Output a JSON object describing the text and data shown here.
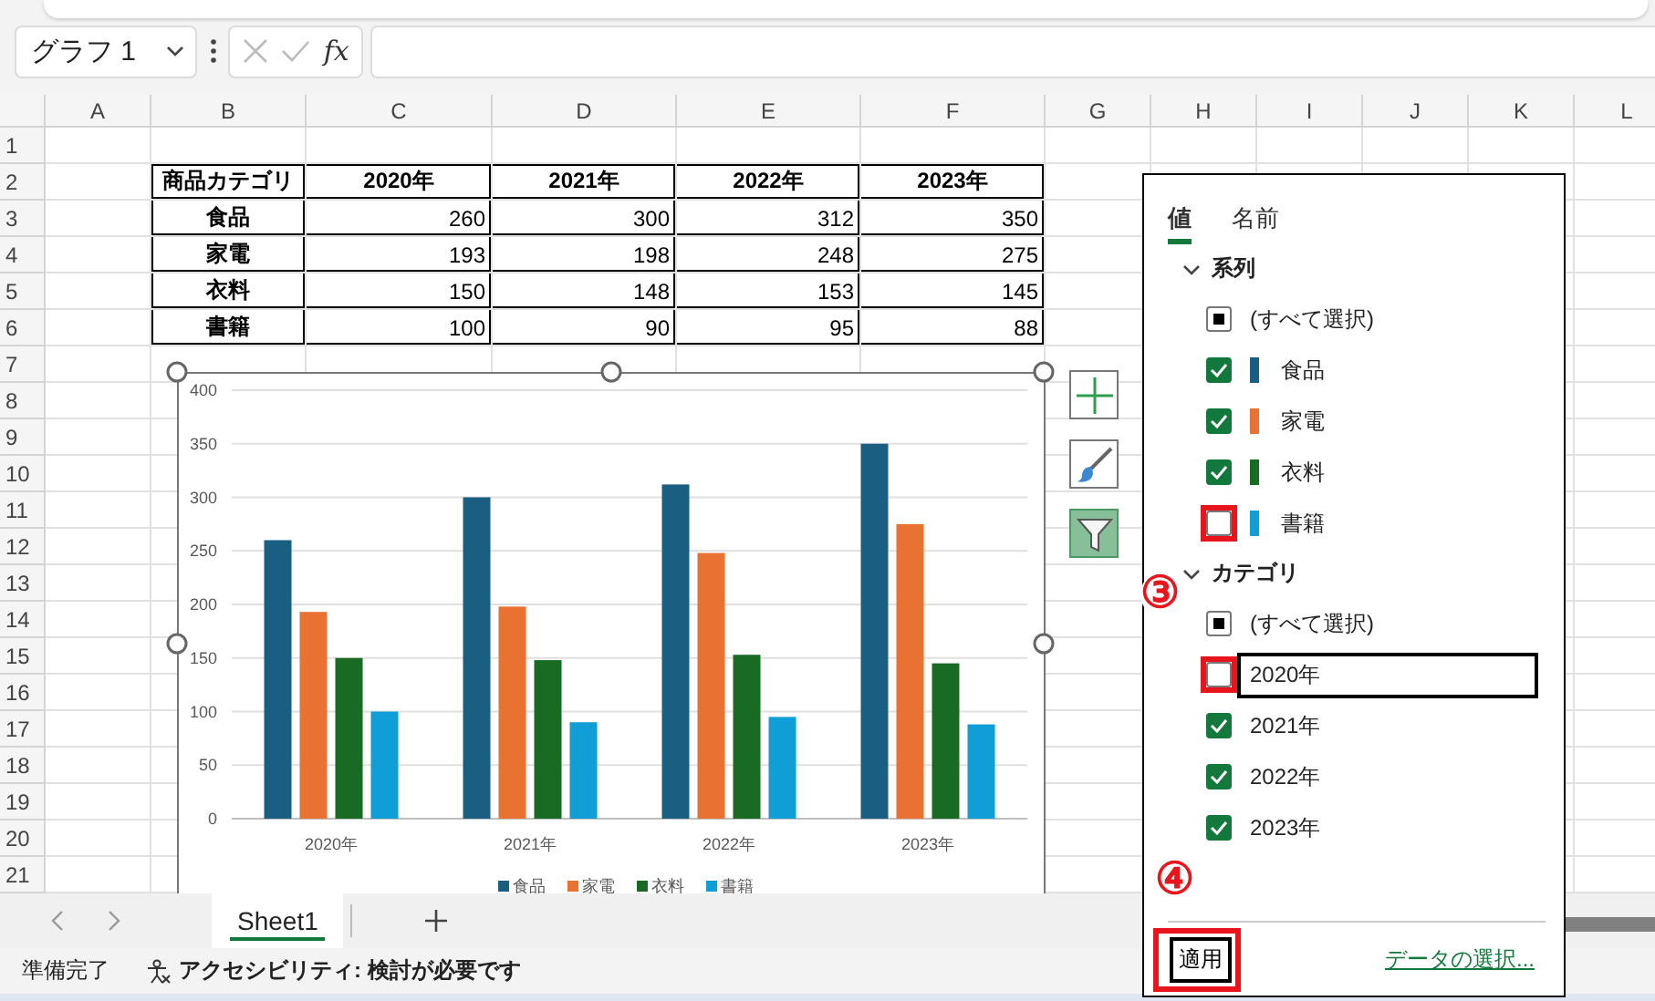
{
  "name_box": {
    "value": "グラフ 1"
  },
  "formula_bar": {
    "function_label": "fx"
  },
  "sheet": {
    "columns": [
      "A",
      "B",
      "C",
      "D",
      "E",
      "F",
      "G",
      "H",
      "I",
      "J",
      "K",
      "L"
    ],
    "rows": [
      "1",
      "2",
      "3",
      "4",
      "5",
      "6",
      "7",
      "8",
      "9",
      "10",
      "11",
      "12",
      "13",
      "14",
      "15",
      "16",
      "17",
      "18",
      "19",
      "20",
      "21"
    ],
    "table": {
      "header": [
        "商品カテゴリ",
        "2020年",
        "2021年",
        "2022年",
        "2023年"
      ],
      "rows": [
        {
          "category": "食品",
          "values": [
            "260",
            "300",
            "312",
            "350"
          ]
        },
        {
          "category": "家電",
          "values": [
            "193",
            "198",
            "248",
            "275"
          ]
        },
        {
          "category": "衣料",
          "values": [
            "150",
            "148",
            "153",
            "145"
          ]
        },
        {
          "category": "書籍",
          "values": [
            "100",
            "90",
            "95",
            "88"
          ]
        }
      ]
    }
  },
  "chart": {
    "chart_data": {
      "type": "bar",
      "categories": [
        "2020年",
        "2021年",
        "2022年",
        "2023年"
      ],
      "series": [
        {
          "name": "食品",
          "color": "#1a5e82",
          "values": [
            260,
            300,
            312,
            350
          ]
        },
        {
          "name": "家電",
          "color": "#e97132",
          "values": [
            193,
            198,
            248,
            275
          ]
        },
        {
          "name": "衣料",
          "color": "#196b24",
          "values": [
            150,
            148,
            153,
            145
          ]
        },
        {
          "name": "書籍",
          "color": "#0f9ed5",
          "values": [
            100,
            90,
            95,
            88
          ]
        }
      ],
      "grid": true,
      "legend": true,
      "ylim": [
        0,
        400
      ],
      "yticks": [
        {
          "value": 0,
          "label": "0"
        },
        {
          "value": 50,
          "label": "50"
        },
        {
          "value": 100,
          "label": "100"
        },
        {
          "value": 150,
          "label": "150"
        },
        {
          "value": 200,
          "label": "200"
        },
        {
          "value": 250,
          "label": "250"
        },
        {
          "value": 300,
          "label": "300"
        },
        {
          "value": 350,
          "label": "350"
        },
        {
          "value": 400,
          "label": "400"
        }
      ]
    }
  },
  "chart_buttons": [
    {
      "kind": "elements",
      "selected": false
    },
    {
      "kind": "styles",
      "selected": false
    },
    {
      "kind": "filter",
      "selected": true
    }
  ],
  "filter_pane": {
    "tabs": [
      {
        "label": "値",
        "selected": true
      },
      {
        "label": "名前",
        "selected": false
      }
    ],
    "sections": [
      {
        "title": "系列",
        "expanded": true,
        "items": [
          {
            "kind": "all",
            "label": "(すべて選択)",
            "indeterminate": true,
            "focused": false,
            "highlighted": false
          },
          {
            "kind": "series",
            "label": "食品",
            "color": "#1a5e82",
            "checked": true,
            "focused": false,
            "highlighted": false
          },
          {
            "kind": "series",
            "label": "家電",
            "color": "#e97132",
            "checked": true,
            "focused": false,
            "highlighted": false
          },
          {
            "kind": "series",
            "label": "衣料",
            "color": "#196b24",
            "checked": true,
            "focused": false,
            "highlighted": false
          },
          {
            "kind": "series",
            "label": "書籍",
            "color": "#0f9ed5",
            "checked": false,
            "focused": false,
            "highlighted": true
          }
        ]
      },
      {
        "title": "カテゴリ",
        "expanded": true,
        "items": [
          {
            "kind": "all",
            "label": "(すべて選択)",
            "indeterminate": true,
            "focused": false,
            "highlighted": false
          },
          {
            "kind": "category",
            "label": "2020年",
            "checked": false,
            "focused": true,
            "highlighted": true
          },
          {
            "kind": "category",
            "label": "2021年",
            "checked": true,
            "focused": false,
            "highlighted": false
          },
          {
            "kind": "category",
            "label": "2022年",
            "checked": true,
            "focused": false,
            "highlighted": false
          },
          {
            "kind": "category",
            "label": "2023年",
            "checked": true,
            "focused": false,
            "highlighted": false
          }
        ]
      }
    ],
    "apply_button": {
      "label": "適用",
      "highlighted": true
    },
    "link": "データの選択..."
  },
  "step_marks": [
    {
      "label": "③"
    },
    {
      "label": "④"
    }
  ],
  "sheet_tabs": [
    {
      "label": "Sheet1",
      "selected": true
    }
  ],
  "status_bar": {
    "ready": "準備完了",
    "accessibility": "アクセシビリティ: 検討が必要です"
  }
}
